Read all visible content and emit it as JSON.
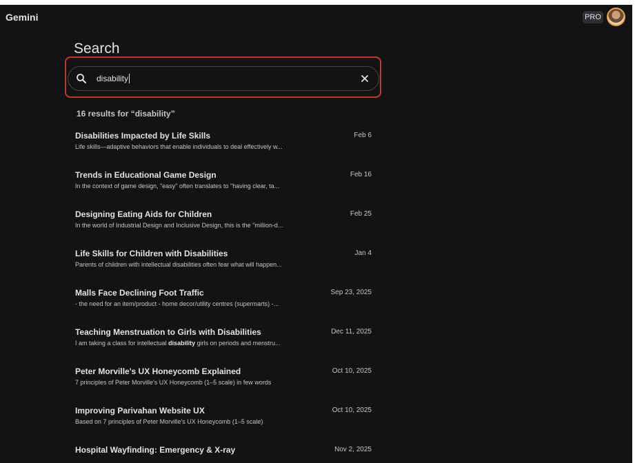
{
  "app": {
    "name": "Gemini",
    "plan_badge": "PRO"
  },
  "page": {
    "heading": "Search"
  },
  "search": {
    "value": "disability"
  },
  "results_summary": "16 results for “disability”",
  "results": [
    {
      "title": "Disabilities Impacted by Life Skills",
      "snippet_before": "Life skills—adaptive behaviors that enable individuals to deal effectively w...",
      "snippet_match": "",
      "snippet_after": "",
      "date": "Feb 6"
    },
    {
      "title": "Trends in Educational Game Design",
      "snippet_before": "In the context of game design, \"easy\" often translates to \"having clear, ta...",
      "snippet_match": "",
      "snippet_after": "",
      "date": "Feb 16"
    },
    {
      "title": "Designing Eating Aids for Children",
      "snippet_before": "In the world of Industrial Design and Inclusive Design, this is the \"million-d...",
      "snippet_match": "",
      "snippet_after": "",
      "date": "Feb 25"
    },
    {
      "title": "Life Skills for Children with Disabilities",
      "snippet_before": "Parents of children with intellectual disabilities often fear what will happen...",
      "snippet_match": "",
      "snippet_after": "",
      "date": "Jan 4"
    },
    {
      "title": "Malls Face Declining Foot Traffic",
      "snippet_before": "- the need for an item/product - home decor/utility centres (supermarts) -...",
      "snippet_match": "",
      "snippet_after": "",
      "date": "Sep 23, 2025"
    },
    {
      "title": "Teaching Menstruation to Girls with Disabilities",
      "snippet_before": "I am taking a class for intellectual ",
      "snippet_match": "disability",
      "snippet_after": " girls on periods and menstru...",
      "date": "Dec 11, 2025"
    },
    {
      "title": "Peter Morville's UX Honeycomb Explained",
      "snippet_before": "7 principles of Peter Morville's UX Honeycomb (1–5 scale) in few words",
      "snippet_match": "",
      "snippet_after": "",
      "date": "Oct 10, 2025"
    },
    {
      "title": "Improving Parivahan Website UX",
      "snippet_before": "Based on 7 principles of Peter Morville's UX Honeycomb (1–5 scale)",
      "snippet_match": "",
      "snippet_after": "",
      "date": "Oct 10, 2025"
    },
    {
      "title": "Hospital Wayfinding: Emergency & X-ray",
      "snippet_before": "",
      "snippet_match": "",
      "snippet_after": "",
      "date": "Nov 2, 2025"
    }
  ],
  "colors": {
    "background": "#131314",
    "text_primary": "#e3e3e3",
    "text_secondary": "#c4c7c5",
    "search_border": "#444746",
    "annotation": "#c0392b"
  },
  "icons": {
    "search": "search-icon",
    "clear": "close-icon",
    "avatar": "avatar"
  }
}
